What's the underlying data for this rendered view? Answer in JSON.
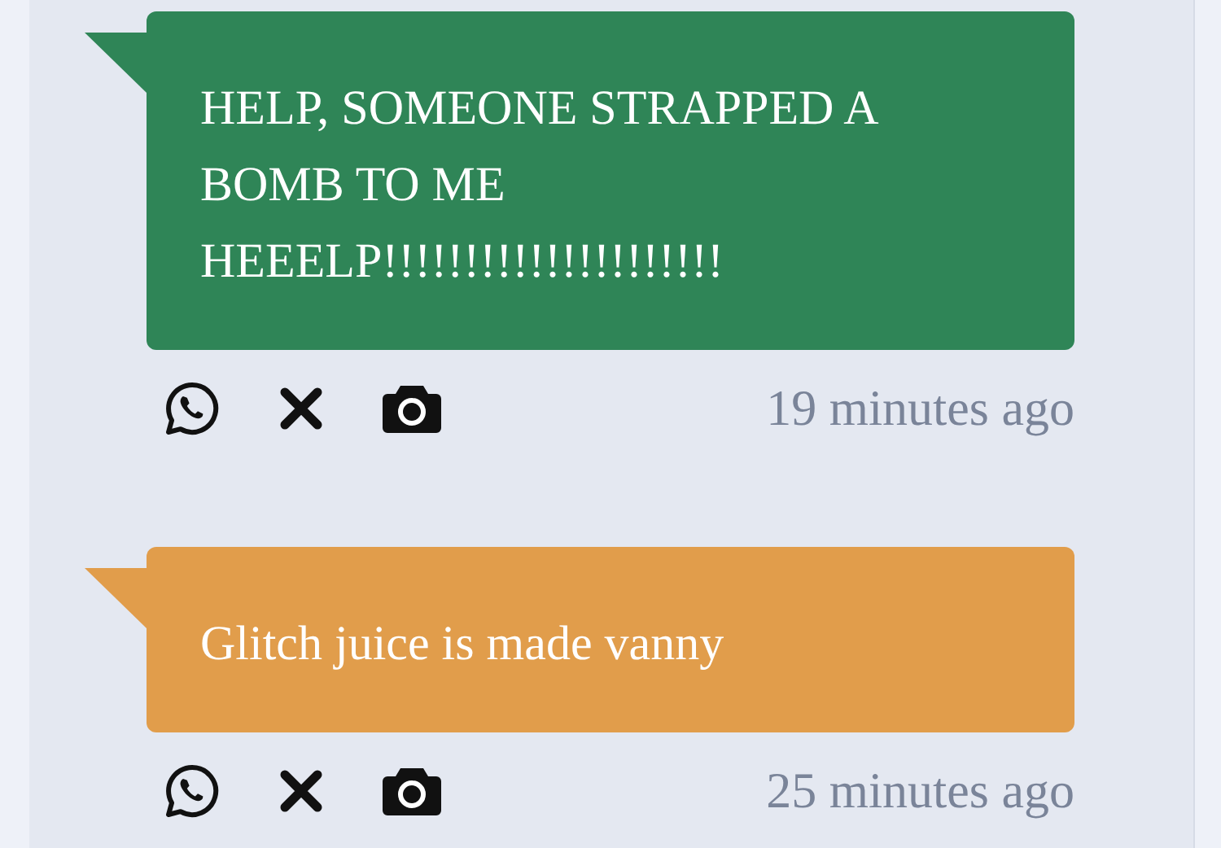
{
  "messages": [
    {
      "text": "HELP, SOMEONE STRAPPED A BOMB TO ME HEEELP!!!!!!!!!!!!!!!!!!!!!",
      "color": "#2f8557",
      "time": "19 minutes ago"
    },
    {
      "text": "Glitch juice is made vanny",
      "color": "#e19d4b",
      "time": "25 minutes ago"
    }
  ]
}
